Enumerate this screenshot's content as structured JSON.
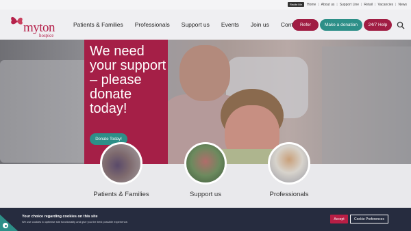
{
  "utility": {
    "accessibility_label": "Recite Me",
    "links": [
      "Home",
      "About us",
      "Support Line",
      "Retail",
      "Vacancies",
      "News"
    ]
  },
  "logo": {
    "word": "myton",
    "sub": "hospice"
  },
  "nav": [
    "Patients & Families",
    "Professionals",
    "Support us",
    "Events",
    "Join us",
    "Contact"
  ],
  "header_buttons": {
    "refer": "Refer",
    "donate": "Make a donation",
    "help": "24/7 Help"
  },
  "hero": {
    "headline": "We need your support – please donate today!",
    "cta": "Donate Today!"
  },
  "sections": [
    "Patients & Families",
    "Support us",
    "Professionals"
  ],
  "cookie": {
    "title": "Your choice regarding cookies on this site",
    "text": "We use cookies to optimise site functionality and give you the best possible experience.",
    "accept": "Accept",
    "preferences": "Cookie Preferences"
  },
  "colors": {
    "brand": "#a51f47",
    "teal": "#2d8f88",
    "banner": "#262c3f"
  }
}
